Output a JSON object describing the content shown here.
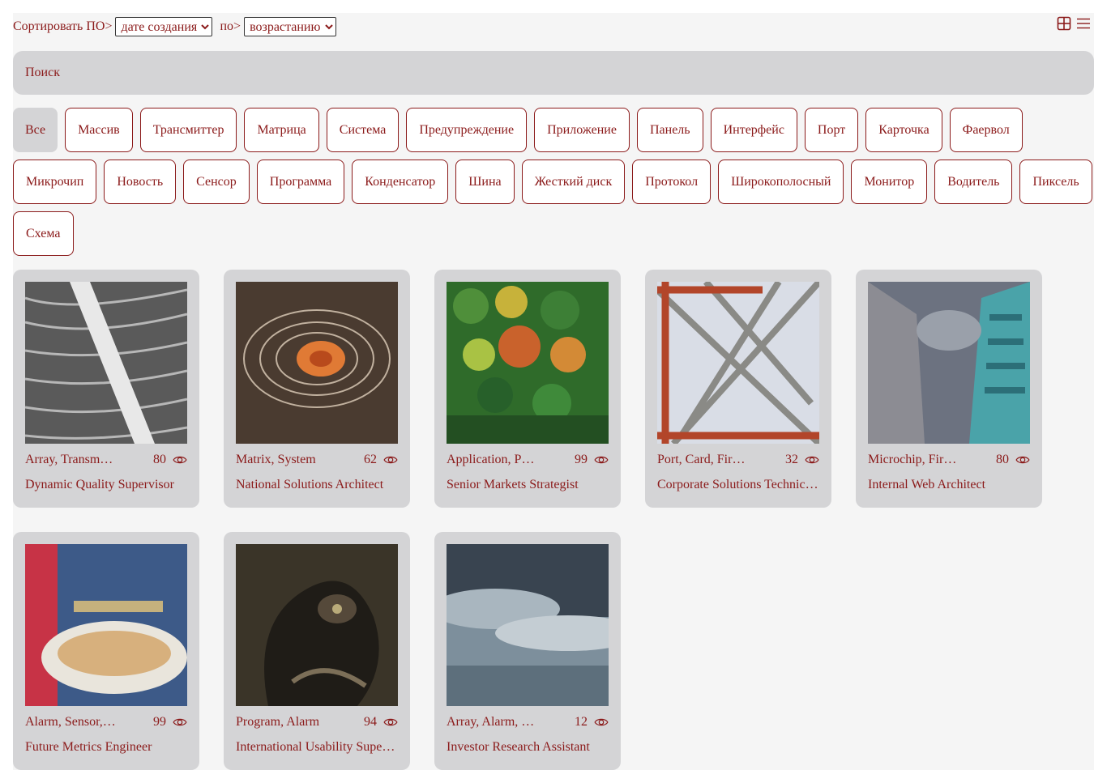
{
  "sort": {
    "label": "Сортировать ПО>",
    "field_selected": "дате создания",
    "by_label": "по>",
    "order_selected": "возрастанию"
  },
  "view_toggle": {
    "grid_icon": "grid-view-icon",
    "list_icon": "list-view-icon"
  },
  "search": {
    "placeholder": "Поиск"
  },
  "tags": [
    "Все",
    "Массив",
    "Трансмиттер",
    "Матрица",
    "Система",
    "Предупреждение",
    "Приложение",
    "Панель",
    "Интерфейс",
    "Порт",
    "Карточка",
    "Фаервол",
    "Микрочип",
    "Новость",
    "Сенсор",
    "Программа",
    "Конденсатор",
    "Шина",
    "Жесткий диск",
    "Протокол",
    "Широкополосный",
    "Монитор",
    "Водитель",
    "Пиксель",
    "Схема"
  ],
  "active_tag": "Все",
  "cards": [
    {
      "tags": "Array, Transmitter",
      "views": "80",
      "title": "Dynamic Quality Supervisor",
      "image": "snow-ice-texture"
    },
    {
      "tags": "Matrix, System",
      "views": "62",
      "title": "National Solutions Architect",
      "image": "abstract-swirl"
    },
    {
      "tags": "Application, Panel",
      "views": "99",
      "title": "Senior Markets Strategist",
      "image": "aerial-forest"
    },
    {
      "tags": "Port, Card, Firewall",
      "views": "32",
      "title": "Corporate Solutions Technician",
      "image": "steel-truss"
    },
    {
      "tags": "Microchip, Firewall",
      "views": "80",
      "title": "Internal Web Architect",
      "image": "skyscrapers"
    },
    {
      "tags": "Alarm, Sensor, Bus",
      "views": "99",
      "title": "Future Metrics Engineer",
      "image": "funnel-cake"
    },
    {
      "tags": "Program, Alarm",
      "views": "94",
      "title": "International Usability Supervisor",
      "image": "surreal-face"
    },
    {
      "tags": "Array, Alarm, Bus",
      "views": "12",
      "title": "Investor Research Assistant",
      "image": "cloudy-sea"
    }
  ],
  "colors": {
    "accent": "#8b1a1a",
    "panel": "#d4d4d6",
    "background": "#f5f5f5"
  }
}
